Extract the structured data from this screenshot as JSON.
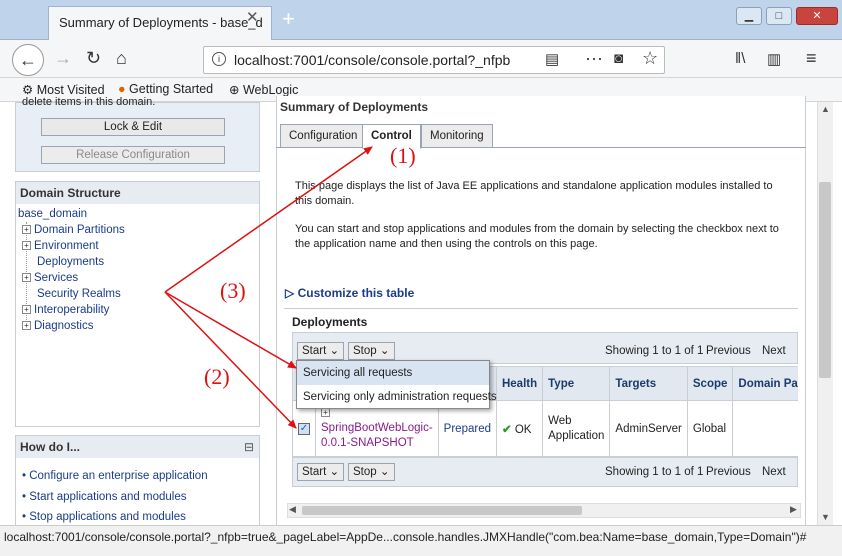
{
  "browser": {
    "tab_title": "Summary of Deployments - base_d",
    "tab_close": "✕",
    "new_tab": "+",
    "url": "localhost:7001/console/console.portal?_nfpb",
    "bookmarks": [
      "Most Visited",
      "Getting Started",
      "WebLogic"
    ],
    "status_url": "localhost:7001/console/console.portal?_nfpb=true&_pageLabel=AppDe...console.handles.JMXHandle(\"com.bea:Name=base_domain,Type=Domain\")#"
  },
  "left": {
    "change_center_text": "delete items in this domain.",
    "lock_edit": "Lock & Edit",
    "release_config": "Release Configuration",
    "domain_structure": {
      "title": "Domain Structure",
      "root": "base_domain",
      "items": [
        {
          "label": "Domain Partitions",
          "expandable": true
        },
        {
          "label": "Environment",
          "expandable": true
        },
        {
          "label": "Deployments",
          "expandable": false
        },
        {
          "label": "Services",
          "expandable": true
        },
        {
          "label": "Security Realms",
          "expandable": false
        },
        {
          "label": "Interoperability",
          "expandable": true
        },
        {
          "label": "Diagnostics",
          "expandable": true
        }
      ]
    },
    "how_do_i": {
      "title": "How do I...",
      "collapse": "⊟",
      "items": [
        "Configure an enterprise application",
        "Start applications and modules",
        "Stop applications and modules"
      ]
    }
  },
  "main": {
    "title": "Summary of Deployments",
    "tabs": [
      "Configuration",
      "Control",
      "Monitoring"
    ],
    "active_tab": "Control",
    "desc1": "This page displays the list of Java EE applications and standalone application modules installed to this domain.",
    "desc2": "You can start and stop applications and modules from the domain by selecting the checkbox next to the application name and then using the controls on this page.",
    "customize": "Customize this table",
    "deployments_label": "Deployments",
    "start_btn": "Start",
    "stop_btn": "Stop",
    "paging": "Showing 1 to 1 of 1",
    "previous": "Previous",
    "next": "Next",
    "start_menu": [
      "Servicing all requests",
      "Servicing only administration requests"
    ],
    "columns": [
      "Health",
      "Type",
      "Targets",
      "Scope",
      "Domain Partiti"
    ],
    "row": {
      "name": "SpringBootWebLogic-0.0.1-SNAPSHOT",
      "state": "Prepared",
      "health": "OK",
      "type": "Web Application",
      "targets": "AdminServer",
      "scope": "Global",
      "checked": true
    }
  },
  "annotations": [
    "(1)",
    "(2)",
    "(3)"
  ],
  "colors": {
    "annotation": "#dd1111",
    "link": "#1a3c8a",
    "header_bg": "#e1e8f0"
  }
}
